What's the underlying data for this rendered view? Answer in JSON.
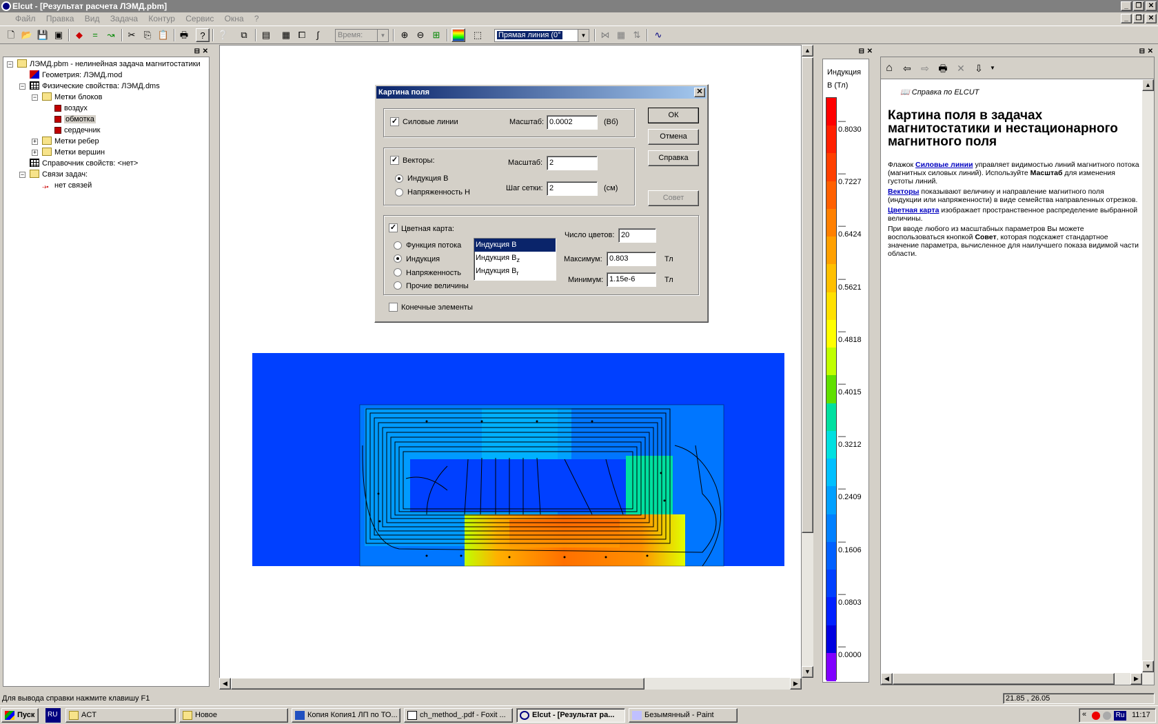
{
  "window": {
    "title": "Elcut - [Результат расчета ЛЭМД.pbm]"
  },
  "menu": [
    "Файл",
    "Правка",
    "Вид",
    "Задача",
    "Контур",
    "Сервис",
    "Окна",
    "?"
  ],
  "toolbar": {
    "time_label": "Время:",
    "line_combo": "Прямая линия (0°"
  },
  "tree": {
    "items": [
      "ЛЭМД.pbm - нелинейная задача магнитостатики",
      "Геометрия: ЛЭМД.mod",
      "Физические свойства: ЛЭМД.dms",
      "Метки блоков",
      "воздух",
      "обмотка",
      "сердечник",
      "Метки ребер",
      "Метки вершин",
      "Справочник свойств: <нет>",
      "Связи задач:",
      "нет связей"
    ]
  },
  "dialog": {
    "title": "Картина поля",
    "field_lines": {
      "label": "Силовые линии",
      "scale_label": "Масштаб:",
      "scale_value": "0.0002",
      "unit": "(Вб)"
    },
    "vectors": {
      "label": "Векторы:",
      "scale_label": "Масштаб:",
      "scale_value": "2",
      "opt1": "Индукция В",
      "opt2": "Напряженность Н",
      "step_label": "Шаг сетки:",
      "step_value": "2",
      "step_unit": "(см)"
    },
    "color_map": {
      "label": "Цветная карта:",
      "opt1": "Функция потока",
      "opt2": "Индукция",
      "opt3": "Напряженность",
      "opt4": "Прочие величины",
      "list": [
        "Индукция В",
        "Индукция B",
        "Индукция B"
      ],
      "list_sub": [
        "",
        "z",
        "r"
      ],
      "count_label": "Число цветов:",
      "count_value": "20",
      "max_label": "Максимум:",
      "max_value": "0.803",
      "min_label": "Минимум:",
      "min_value": "1.15e-6",
      "unit": "Тл"
    },
    "fe_label": "Конечные элементы",
    "ok": "ОК",
    "cancel": "Отмена",
    "help": "Справка",
    "advice": "Совет"
  },
  "scale": {
    "title1": "Индукция",
    "title2": "В (Тл)",
    "ticks": [
      "0.8030",
      "0.7227",
      "0.6424",
      "0.5621",
      "0.4818",
      "0.4015",
      "0.3212",
      "0.2409",
      "0.1606",
      "0.0803",
      "0.0000"
    ],
    "colors": [
      "#ff0000",
      "#ff2000",
      "#ff4000",
      "#ff6000",
      "#ff8000",
      "#ffa000",
      "#ffc000",
      "#ffe000",
      "#ffff00",
      "#c0ff00",
      "#60e000",
      "#00e0a0",
      "#00e0e0",
      "#00c0ff",
      "#00a0ff",
      "#0080ff",
      "#0060ff",
      "#0040ff",
      "#0020ff",
      "#0000e0",
      "#8000ff"
    ]
  },
  "help": {
    "link": "Справка по ELCUT",
    "heading": "Картина поля в задачах магнитостатики и нестационарного магнитного поля",
    "p1_pre": "Флажок ",
    "p1_link": "Силовые линии",
    "p1_text": " управляет видимостью линий магнитного потока (магнитных силовых линий). Используйте ",
    "p1_bold": "Масштаб",
    "p1_end": " для изменения густоты линий.",
    "p2_link": "Векторы",
    "p2_text": " показывают величину и направление магнитного поля (индукции или напряженности) в виде семейства направленных отрезков.",
    "p3_link": "Цветная карта",
    "p3_text": " изображает пространственное распределение выбранной величины.",
    "p4_pre": "При вводе любого из масштабных параметров Вы можете воспользоваться кнопкой ",
    "p4_bold": "Совет",
    "p4_end": ", которая подскажет стандартное значение параметра, вычисленное для наилучшего показа видимой части области."
  },
  "status": {
    "text": "Для вывода справки нажмите клавишу F1",
    "coords": "21.85 , 26.05"
  },
  "taskbar": {
    "start": "Пуск",
    "lang": "RU",
    "tasks": [
      "ACT",
      "Новое",
      "Копия Копия1 ЛП по ТО...",
      "ch_method_.pdf - Foxit ...",
      "Elcut - [Результат ра...",
      "Безымянный - Paint"
    ],
    "tray_lang": "Ru",
    "clock": "11:17"
  }
}
